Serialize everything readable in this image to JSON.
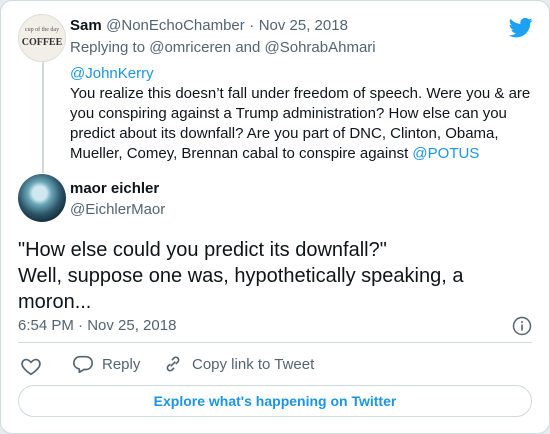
{
  "parent_tweet": {
    "avatar_text_top": "cup of the day",
    "avatar_text_main": "COFFEE",
    "name": "Sam",
    "handle": "@NonEchoChamber",
    "separator": "·",
    "date": "Nov 25, 2018",
    "replying_prefix": "Replying to",
    "replying_user1": "@omriceren",
    "replying_and": "and",
    "replying_user2": "@SohrabAhmari",
    "mention": "@JohnKerry",
    "text_line1": "You realize this doesn’t fall under freedom of speech. Were you & are",
    "text_line2": "you conspiring against a Trump administration? How else can you",
    "text_line3": "predict about its downfall? Are you part of DNC, Clinton, Obama,",
    "text_line4": "Mueller, Comey, Brennan cabal to conspire against",
    "text_mention_end": "@POTUS"
  },
  "main_tweet": {
    "name": "maor eichler",
    "handle": "@EichlerMaor",
    "line1": "\"How else could you predict its downfall?\"",
    "line2": "Well, suppose one was, hypothetically speaking, a",
    "line3": "moron...",
    "timestamp": "6:54 PM · Nov 25, 2018"
  },
  "actions": {
    "reply_label": "Reply",
    "copy_label": "Copy link to Tweet"
  },
  "explore_label": "Explore what's happening on Twitter",
  "icons": {
    "brand": "twitter-bird-icon",
    "info": "info-icon",
    "like": "heart-icon",
    "reply": "reply-bubble-icon",
    "link": "link-icon"
  },
  "colors": {
    "accent": "#1b95e0",
    "text": "#0f1419",
    "muted": "#536471"
  }
}
